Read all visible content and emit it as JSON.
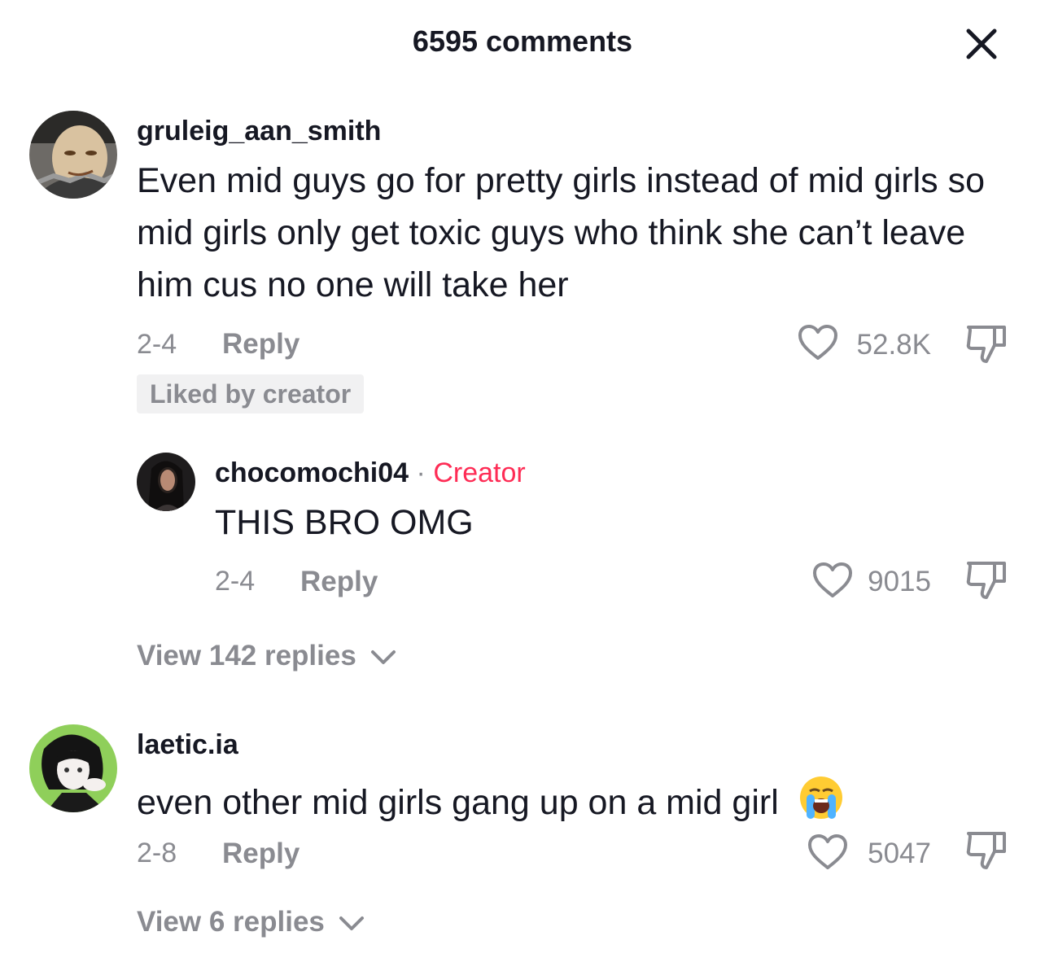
{
  "header": {
    "title": "6595 comments"
  },
  "comments": [
    {
      "username": "gruleig_aan_smith",
      "text": "Even mid guys go for pretty girls instead of mid girls so mid girls only get toxic guys who think she can’t leave him cus no one will take her",
      "date": "2-4",
      "reply_label": "Reply",
      "likes": "52.8K",
      "badge": "Liked by creator",
      "replies": [
        {
          "username": "chocomochi04",
          "separator": "·",
          "tag": "Creator",
          "text": "THIS BRO OMG",
          "date": "2-4",
          "reply_label": "Reply",
          "likes": "9015"
        }
      ],
      "view_replies": "View 142 replies"
    },
    {
      "username": "laetic.ia",
      "text": "even other mid girls gang up on a mid girl",
      "emoji": "loudly-crying-face",
      "date": "2-8",
      "reply_label": "Reply",
      "likes": "5047",
      "view_replies": "View 6 replies"
    }
  ],
  "colors": {
    "primary_text": "#161823",
    "secondary_text": "#8a8b91",
    "creator_tag": "#fe2c55",
    "badge_bg": "#f1f1f2"
  }
}
